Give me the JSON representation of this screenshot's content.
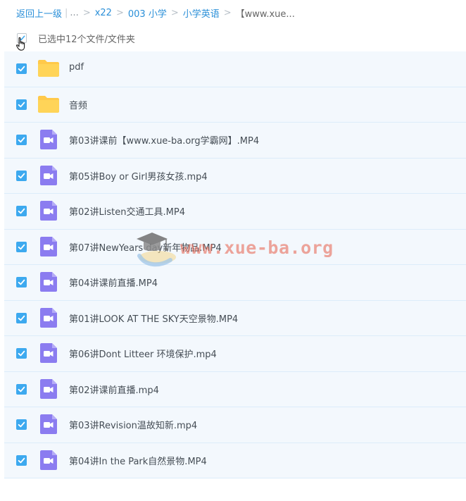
{
  "breadcrumb": {
    "back_label": "返回上一级",
    "ellipsis": "...",
    "items": [
      "x22",
      "003 小学",
      "小学英语"
    ],
    "current": "【www.xue..."
  },
  "selection": {
    "summary": "已选中12个文件/文件夹",
    "all_checked": true
  },
  "files": [
    {
      "name": "pdf",
      "type": "folder",
      "checked": true
    },
    {
      "name": "音频",
      "type": "folder",
      "checked": true
    },
    {
      "name": "第03讲课前【www.xue-ba.org学霸网】.MP4",
      "type": "video",
      "checked": true
    },
    {
      "name": "第05讲Boy or Girl男孩女孩.mp4",
      "type": "video",
      "checked": true
    },
    {
      "name": "第02讲Listen交通工具.MP4",
      "type": "video",
      "checked": true
    },
    {
      "name": "第07讲NewYears day新年物品.MP4",
      "type": "video",
      "checked": true
    },
    {
      "name": "第04讲课前直播.MP4",
      "type": "video",
      "checked": true
    },
    {
      "name": "第01讲LOOK AT THE SKY天空景物.MP4",
      "type": "video",
      "checked": true
    },
    {
      "name": "第06讲Dont Litteer 环境保护.mp4",
      "type": "video",
      "checked": true
    },
    {
      "name": "第02讲课前直播.mp4",
      "type": "video",
      "checked": true
    },
    {
      "name": "第03讲Revision温故知新.mp4",
      "type": "video",
      "checked": true
    },
    {
      "name": "第04讲In the Park自然景物.MP4",
      "type": "video",
      "checked": true
    }
  ],
  "watermark": {
    "text": "www.xue-ba.org",
    "color": "#e7705d"
  },
  "colors": {
    "link": "#2a8fd8",
    "checkbox": "#3da9ef",
    "row_selected_bg": "#f3f8fd",
    "folder": "#ffc94a",
    "video": "#8b7cf0"
  },
  "icons": {
    "folder": "folder-icon",
    "video": "video-file-icon",
    "check": "checkmark-icon",
    "cursor": "hand-cursor-icon",
    "watermark_logo": "graduation-cap-icon"
  }
}
